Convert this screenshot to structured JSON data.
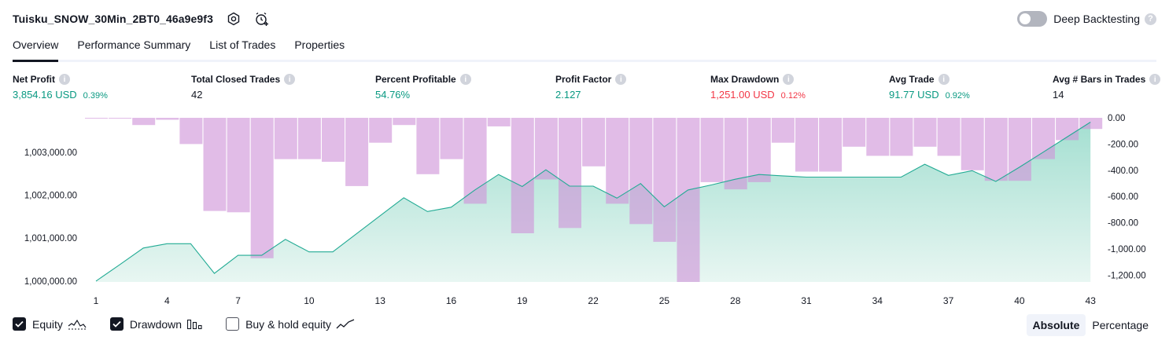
{
  "header": {
    "strategy_name": "Tuisku_SNOW_30Min_2BT0_46a9e9f3",
    "settings_icon": "gear-icon",
    "add_alert_icon": "alarm-plus-icon"
  },
  "deep_backtesting": {
    "label": "Deep Backtesting",
    "enabled": false,
    "help": "?"
  },
  "tabs": [
    {
      "label": "Overview",
      "active": true
    },
    {
      "label": "Performance Summary",
      "active": false
    },
    {
      "label": "List of Trades",
      "active": false
    },
    {
      "label": "Properties",
      "active": false
    }
  ],
  "metrics": [
    {
      "label": "Net Profit",
      "value": "3,854.16 USD",
      "pct": "0.39%",
      "color": "green"
    },
    {
      "label": "Total Closed Trades",
      "value": "42",
      "pct": "",
      "color": "dark"
    },
    {
      "label": "Percent Profitable",
      "value": "54.76%",
      "pct": "",
      "color": "green"
    },
    {
      "label": "Profit Factor",
      "value": "2.127",
      "pct": "",
      "color": "green"
    },
    {
      "label": "Max Drawdown",
      "value": "1,251.00 USD",
      "pct": "0.12%",
      "color": "red"
    },
    {
      "label": "Avg Trade",
      "value": "91.77 USD",
      "pct": "0.92%",
      "color": "green"
    },
    {
      "label": "Avg # Bars in Trades",
      "value": "14",
      "pct": "",
      "color": "dark"
    }
  ],
  "info_glyph": "i",
  "chart_data": {
    "type": "area",
    "x_ticks": [
      1,
      4,
      7,
      10,
      13,
      16,
      19,
      22,
      25,
      28,
      31,
      34,
      37,
      40,
      43
    ],
    "left_axis": {
      "labels": [
        "1,003,000.00",
        "1,002,000.00",
        "1,001,000.00",
        "1,000,000.00"
      ],
      "values": [
        1003000,
        1002000,
        1001000,
        1000000
      ],
      "range": [
        999980,
        1003800
      ]
    },
    "right_axis": {
      "labels": [
        "0.00",
        "-200.00",
        "-400.00",
        "-600.00",
        "-800.00",
        "-1,000.00",
        "-1,200.00"
      ],
      "values": [
        0,
        -200,
        -400,
        -600,
        -800,
        -1000,
        -1200
      ],
      "range": [
        -1251,
        0
      ]
    },
    "series": [
      {
        "name": "Equity",
        "color": "#22ab94",
        "x": [
          1,
          2,
          3,
          4,
          5,
          6,
          7,
          8,
          9,
          10,
          11,
          12,
          13,
          14,
          15,
          16,
          17,
          18,
          19,
          20,
          21,
          22,
          23,
          24,
          25,
          26,
          27,
          28,
          29,
          30,
          31,
          32,
          33,
          34,
          35,
          36,
          37,
          38,
          39,
          40,
          41,
          42,
          43
        ],
        "values": [
          1000000,
          1000380,
          1000770,
          1000870,
          1000870,
          1000180,
          1000600,
          1000600,
          1000970,
          1000680,
          1000680,
          1001100,
          1001520,
          1001940,
          1001620,
          1001720,
          1002120,
          1002480,
          1002200,
          1002590,
          1002210,
          1002210,
          1001930,
          1002270,
          1001730,
          1002120,
          1002240,
          1002370,
          1002480,
          1002450,
          1002420,
          1002420,
          1002420,
          1002420,
          1002420,
          1002720,
          1002460,
          1002570,
          1002320,
          1002650,
          1003000,
          1003350,
          1003700
        ]
      },
      {
        "name": "Drawdown",
        "color": "#ce93d8",
        "x": [
          1,
          2,
          3,
          4,
          5,
          6,
          7,
          8,
          9,
          10,
          11,
          12,
          13,
          14,
          15,
          16,
          17,
          18,
          19,
          20,
          21,
          22,
          23,
          24,
          25,
          26,
          27,
          28,
          29,
          30,
          31,
          32,
          33,
          34,
          35,
          36,
          37,
          38,
          39,
          40,
          41,
          42,
          43
        ],
        "values": [
          -5,
          -5,
          -55,
          -15,
          -200,
          -710,
          -720,
          -1070,
          -315,
          -315,
          -335,
          -520,
          -190,
          -55,
          -430,
          -315,
          -655,
          -65,
          -880,
          -470,
          -840,
          -370,
          -655,
          -810,
          -945,
          -1251,
          -490,
          -545,
          -490,
          -190,
          -410,
          -410,
          -220,
          -290,
          -290,
          -220,
          -290,
          -400,
          -480,
          -480,
          -315,
          -170,
          -85
        ]
      }
    ],
    "legend": [
      {
        "label": "Equity",
        "checked": true,
        "glyph": "equity-line-icon"
      },
      {
        "label": "Drawdown",
        "checked": true,
        "glyph": "drawdown-bars-icon"
      },
      {
        "label": "Buy & hold equity",
        "checked": false,
        "glyph": "buyhold-line-icon"
      }
    ]
  },
  "modes": [
    {
      "label": "Absolute",
      "active": true
    },
    {
      "label": "Percentage",
      "active": false
    }
  ]
}
